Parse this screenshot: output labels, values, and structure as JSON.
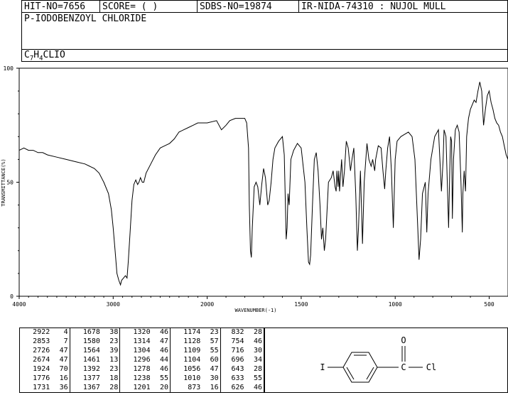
{
  "header": {
    "hit_no": "HIT-NO=7656",
    "score": "SCORE=  (   )",
    "sdbs_no": "SDBS-NO=19874",
    "ir_id": "IR-NIDA-74310 : NUJOL MULL"
  },
  "compound": {
    "name": "P-IODOBENZOYL CHLORIDE",
    "formula_parts": [
      "C",
      "7",
      "H",
      "4",
      "CLIO"
    ]
  },
  "chart_data": {
    "type": "line",
    "xlabel": "WAVENUMBER(-1)",
    "ylabel": "TRANSMITTANCE(%)",
    "xlim": [
      4000,
      400
    ],
    "ylim": [
      0,
      100
    ],
    "x_ticks": [
      "4000",
      "3000",
      "2000",
      "1500",
      "1000",
      "500"
    ],
    "y_ticks": [
      "0",
      "50",
      "100"
    ],
    "series": [
      {
        "color": "#000000",
        "points": [
          [
            4000,
            64
          ],
          [
            3950,
            65
          ],
          [
            3900,
            64
          ],
          [
            3850,
            64
          ],
          [
            3800,
            63
          ],
          [
            3750,
            63
          ],
          [
            3700,
            62
          ],
          [
            3600,
            61
          ],
          [
            3500,
            60
          ],
          [
            3400,
            59
          ],
          [
            3300,
            58
          ],
          [
            3250,
            57
          ],
          [
            3200,
            56
          ],
          [
            3150,
            54
          ],
          [
            3100,
            50
          ],
          [
            3050,
            45
          ],
          [
            3020,
            38
          ],
          [
            3000,
            30
          ],
          [
            2980,
            20
          ],
          [
            2960,
            10
          ],
          [
            2940,
            7
          ],
          [
            2922,
            5
          ],
          [
            2910,
            7
          ],
          [
            2890,
            8
          ],
          [
            2870,
            9
          ],
          [
            2853,
            8
          ],
          [
            2840,
            15
          ],
          [
            2820,
            28
          ],
          [
            2800,
            42
          ],
          [
            2780,
            49
          ],
          [
            2760,
            51
          ],
          [
            2740,
            49
          ],
          [
            2726,
            50
          ],
          [
            2710,
            52
          ],
          [
            2690,
            50
          ],
          [
            2674,
            50
          ],
          [
            2650,
            54
          ],
          [
            2600,
            58
          ],
          [
            2550,
            62
          ],
          [
            2500,
            65
          ],
          [
            2450,
            66
          ],
          [
            2400,
            67
          ],
          [
            2350,
            69
          ],
          [
            2300,
            72
          ],
          [
            2250,
            73
          ],
          [
            2200,
            74
          ],
          [
            2150,
            75
          ],
          [
            2100,
            76
          ],
          [
            2050,
            76
          ],
          [
            2000,
            76
          ],
          [
            1950,
            77
          ],
          [
            1924,
            73
          ],
          [
            1900,
            75
          ],
          [
            1880,
            77
          ],
          [
            1850,
            78
          ],
          [
            1820,
            78
          ],
          [
            1800,
            78
          ],
          [
            1790,
            76
          ],
          [
            1780,
            65
          ],
          [
            1776,
            40
          ],
          [
            1770,
            20
          ],
          [
            1765,
            17
          ],
          [
            1760,
            30
          ],
          [
            1750,
            48
          ],
          [
            1740,
            50
          ],
          [
            1731,
            48
          ],
          [
            1720,
            40
          ],
          [
            1710,
            49
          ],
          [
            1700,
            56
          ],
          [
            1690,
            52
          ],
          [
            1678,
            40
          ],
          [
            1670,
            42
          ],
          [
            1660,
            50
          ],
          [
            1650,
            60
          ],
          [
            1640,
            65
          ],
          [
            1620,
            68
          ],
          [
            1600,
            70
          ],
          [
            1590,
            62
          ],
          [
            1580,
            25
          ],
          [
            1575,
            30
          ],
          [
            1570,
            45
          ],
          [
            1564,
            40
          ],
          [
            1555,
            60
          ],
          [
            1540,
            64
          ],
          [
            1520,
            67
          ],
          [
            1500,
            65
          ],
          [
            1480,
            50
          ],
          [
            1470,
            30
          ],
          [
            1461,
            15
          ],
          [
            1455,
            14
          ],
          [
            1450,
            18
          ],
          [
            1440,
            40
          ],
          [
            1430,
            60
          ],
          [
            1420,
            63
          ],
          [
            1410,
            55
          ],
          [
            1400,
            40
          ],
          [
            1392,
            25
          ],
          [
            1385,
            30
          ],
          [
            1377,
            20
          ],
          [
            1370,
            25
          ],
          [
            1367,
            30
          ],
          [
            1355,
            50
          ],
          [
            1340,
            52
          ],
          [
            1330,
            55
          ],
          [
            1320,
            48
          ],
          [
            1314,
            46
          ],
          [
            1310,
            55
          ],
          [
            1304,
            48
          ],
          [
            1300,
            55
          ],
          [
            1296,
            46
          ],
          [
            1285,
            60
          ],
          [
            1278,
            48
          ],
          [
            1270,
            55
          ],
          [
            1260,
            68
          ],
          [
            1250,
            65
          ],
          [
            1238,
            55
          ],
          [
            1230,
            60
          ],
          [
            1220,
            65
          ],
          [
            1210,
            45
          ],
          [
            1201,
            20
          ],
          [
            1195,
            30
          ],
          [
            1185,
            55
          ],
          [
            1174,
            23
          ],
          [
            1165,
            50
          ],
          [
            1150,
            67
          ],
          [
            1140,
            60
          ],
          [
            1128,
            57
          ],
          [
            1120,
            60
          ],
          [
            1109,
            55
          ],
          [
            1104,
            60
          ],
          [
            1090,
            66
          ],
          [
            1075,
            65
          ],
          [
            1065,
            55
          ],
          [
            1056,
            47
          ],
          [
            1050,
            55
          ],
          [
            1040,
            65
          ],
          [
            1030,
            70
          ],
          [
            1020,
            55
          ],
          [
            1010,
            30
          ],
          [
            1000,
            60
          ],
          [
            990,
            68
          ],
          [
            970,
            70
          ],
          [
            950,
            71
          ],
          [
            930,
            72
          ],
          [
            910,
            70
          ],
          [
            895,
            60
          ],
          [
            880,
            30
          ],
          [
            873,
            16
          ],
          [
            865,
            25
          ],
          [
            855,
            45
          ],
          [
            840,
            50
          ],
          [
            832,
            28
          ],
          [
            825,
            45
          ],
          [
            810,
            60
          ],
          [
            790,
            70
          ],
          [
            770,
            73
          ],
          [
            754,
            46
          ],
          [
            745,
            60
          ],
          [
            740,
            73
          ],
          [
            730,
            70
          ],
          [
            716,
            30
          ],
          [
            710,
            55
          ],
          [
            705,
            70
          ],
          [
            700,
            68
          ],
          [
            696,
            34
          ],
          [
            690,
            60
          ],
          [
            680,
            73
          ],
          [
            670,
            75
          ],
          [
            660,
            72
          ],
          [
            650,
            50
          ],
          [
            643,
            28
          ],
          [
            640,
            45
          ],
          [
            633,
            55
          ],
          [
            626,
            46
          ],
          [
            620,
            70
          ],
          [
            610,
            78
          ],
          [
            600,
            82
          ],
          [
            590,
            84
          ],
          [
            580,
            86
          ],
          [
            570,
            85
          ],
          [
            560,
            90
          ],
          [
            550,
            94
          ],
          [
            540,
            90
          ],
          [
            530,
            75
          ],
          [
            520,
            82
          ],
          [
            510,
            88
          ],
          [
            500,
            90
          ],
          [
            490,
            85
          ],
          [
            480,
            82
          ],
          [
            470,
            78
          ],
          [
            460,
            76
          ],
          [
            450,
            75
          ],
          [
            440,
            72
          ],
          [
            430,
            70
          ],
          [
            420,
            66
          ],
          [
            410,
            62
          ],
          [
            400,
            60
          ]
        ]
      }
    ]
  },
  "peak_table": {
    "columns": [
      [
        [
          "2922",
          "4"
        ],
        [
          "2853",
          "7"
        ],
        [
          "2726",
          "47"
        ],
        [
          "2674",
          "47"
        ],
        [
          "1924",
          "70"
        ],
        [
          "1776",
          "16"
        ],
        [
          "1731",
          "36"
        ]
      ],
      [
        [
          "1678",
          "38"
        ],
        [
          "1580",
          "23"
        ],
        [
          "1564",
          "39"
        ],
        [
          "1461",
          "13"
        ],
        [
          "1392",
          "23"
        ],
        [
          "1377",
          "18"
        ],
        [
          "1367",
          "28"
        ]
      ],
      [
        [
          "1320",
          "46"
        ],
        [
          "1314",
          "47"
        ],
        [
          "1304",
          "46"
        ],
        [
          "1296",
          "44"
        ],
        [
          "1278",
          "46"
        ],
        [
          "1238",
          "55"
        ],
        [
          "1201",
          "20"
        ]
      ],
      [
        [
          "1174",
          "23"
        ],
        [
          "1128",
          "57"
        ],
        [
          "1109",
          "55"
        ],
        [
          "1104",
          "60"
        ],
        [
          "1056",
          "47"
        ],
        [
          "1010",
          "30"
        ],
        [
          "873",
          "16"
        ]
      ],
      [
        [
          "832",
          "28"
        ],
        [
          "754",
          "46"
        ],
        [
          "716",
          "30"
        ],
        [
          "696",
          "34"
        ],
        [
          "643",
          "28"
        ],
        [
          "633",
          "55"
        ],
        [
          "626",
          "46"
        ]
      ]
    ]
  },
  "structure": {
    "iodine": "I",
    "oxygen": "O",
    "carbon": "C",
    "chlorine": "Cl"
  }
}
